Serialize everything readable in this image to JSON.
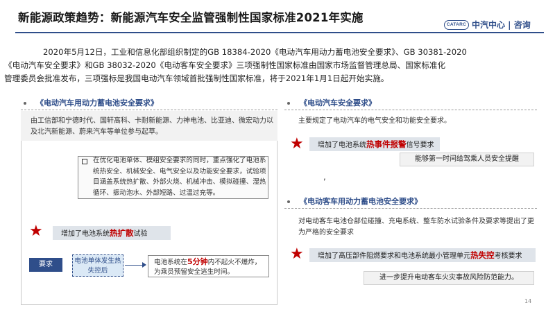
{
  "title": "新能源政策趋势：新能源汽车安全监管强制性国家标准2021年实施",
  "logo": {
    "badge": "CATARC",
    "text": "中汽中心 | 咨询"
  },
  "intro_lines": [
    "2020年5月12日，工业和信息化部组织制定的GB 18384-2020《电动汽车用动力蓄电池安全要求》、GB 30381-2020",
    "《电动汽车安全要求》和GB 38032-2020《电动客车安全要求》三项强制性国家标准由国家市场监督管理总局、国家标准化",
    "管理委员会批准发布，三项强标是我国电动汽车领域首批强制性国家标准，将于2021年1月1日起开始实施。"
  ],
  "left": {
    "heading": "《电动汽车用动力蓄电池安全要求》",
    "top_text": "由工信部和宁德时代、国轩高科、卡耐新能源、力神电池、比亚迪、微宏动力以及北汽新能源、蔚来汽车等单位参与起草。",
    "inner_text": "在优化电池单体、模组安全要求的同时，重点强化了电池系统热安全、机械安全、电气安全以及功能安全要求，试验项目涵盖系统热扩散、外部火烧、机械冲击、模拟碰撞、湿热循环、振动泡水、外部短路、过温过充等。",
    "star": "★",
    "banner_prefix": "增加了电池系统",
    "banner_highlight": "热扩散",
    "banner_suffix": "试验",
    "req_label": "要求",
    "condition": "电池单体发生热失控后",
    "result_prefix": "电池系统在",
    "result_highlight": "5分钟",
    "result_suffix": "内不起火不爆炸，",
    "result_line2": "为乘员预留安全逃生时间。"
  },
  "right_top": {
    "heading": "《电动汽车安全要求》",
    "text": "主要规定了电动汽车的电气安全和功能安全要求。",
    "star": "★",
    "banner_prefix": "增加了电池系统",
    "banner_highlight": "热事件报警",
    "banner_suffix": "信号要求",
    "detail": "能够第一时间给驾乘人员安全提醒"
  },
  "right_bottom": {
    "heading": "《电动客车用动力蓄电池安全要求》",
    "text": "对电动客车电池仓部位碰撞、充电系统、整车防水试验条件及要求等提出了更为严格的安全要求",
    "star": "★",
    "banner_prefix": "增加了高压部件阻燃要求和电池系统最小管理单元",
    "banner_highlight": "热失控",
    "banner_suffix": "考核要求",
    "detail": "进一步提升电动客车火灾事故风险防范能力。"
  },
  "separator": ",",
  "page_number": "14",
  "colors": {
    "accent": "#2f4e8a",
    "highlight": "#c00000"
  }
}
